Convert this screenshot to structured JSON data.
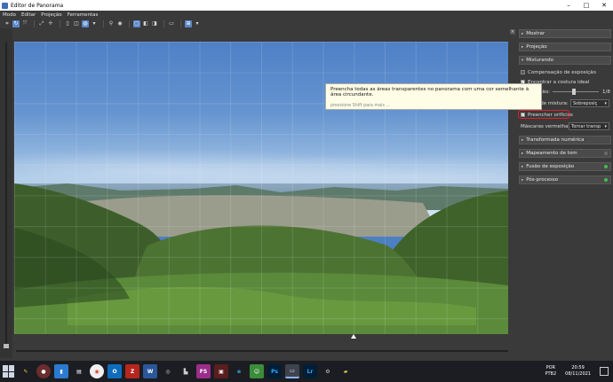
{
  "window": {
    "title": "Editor de Panorama"
  },
  "menubar": {
    "items": [
      "Modo",
      "Editar",
      "Projeção",
      "Ferramentas"
    ]
  },
  "panel": {
    "mostrar": "Mostrar",
    "projecao": "Projeção",
    "misturando": "Misturando",
    "compensacao": "Compensação de exposição",
    "encontrar": "Encontrar a costura ideal",
    "suavizacao": "Suavização:",
    "slider_value": "1/8",
    "metodo": "Método de mistura:",
    "metodo_value": "Sobreposiç",
    "preencher": "Preencher orifícios",
    "mascaras": "Máscaras vermelhas:",
    "mascaras_value": "Tornar transp",
    "transformada": "Transformada numérica",
    "mapeamento": "Mapeamento de tom",
    "fusao": "Fusão de exposição",
    "posprocesso": "Pós-processo"
  },
  "tooltip": {
    "main": "Preencha todas as áreas transparentes no panorama com uma cor semelhante à área circundante.",
    "hint": "pressione Shift para mais ..."
  },
  "tray": {
    "lang1": "POR",
    "lang2": "PTB2",
    "time": "20:59",
    "date": "08/11/2021"
  },
  "colors": {
    "accent": "#5a86c8",
    "highlight": "#e0202a",
    "dot_gray": "#6a6a6a",
    "dot_green": "#3fbf4f"
  },
  "taskbar_icons": [
    "start-icon",
    "paint-icon",
    "app-icon",
    "file-icon",
    "notes-icon",
    "chrome-icon",
    "outlook-icon",
    "filezilla-icon",
    "word-icon",
    "app2-icon",
    "app3-icon",
    "fs-icon",
    "app4-icon",
    "edge-icon",
    "app5-icon",
    "photoshop-icon",
    "app6-icon",
    "lightroom-icon",
    "app7-icon",
    "explorer-icon"
  ]
}
